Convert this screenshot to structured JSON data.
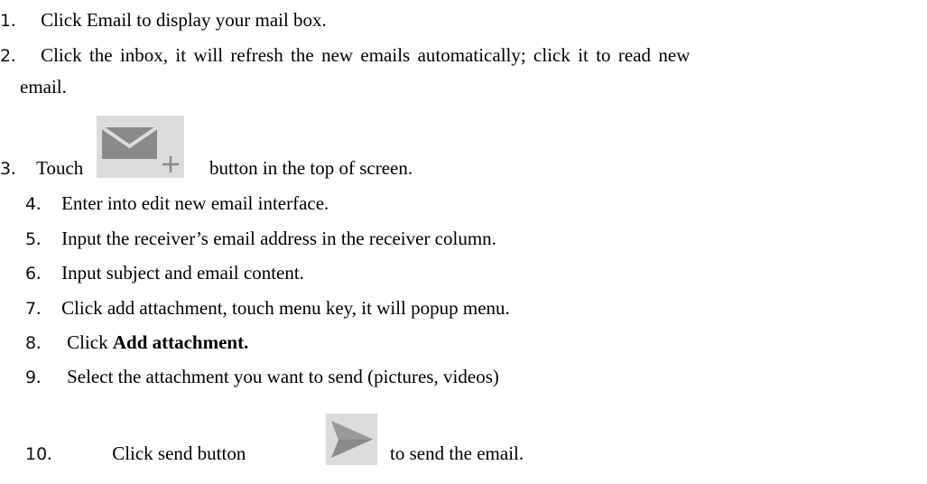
{
  "steps": [
    {
      "num": "1",
      "sep": ".",
      "text": "Click Email to display your mail box."
    },
    {
      "num": "2",
      "sep": ".",
      "text": "Click the inbox, it will refresh the new emails automatically; click it to read new",
      "text_cont": "email."
    },
    {
      "num": "3",
      "sep": ".",
      "text_before": "Touch",
      "text_after": "button in the top of screen.",
      "icon": "compose-email-icon"
    },
    {
      "num": "4",
      "sep": ".",
      "text": "Enter into edit new email interface."
    },
    {
      "num": "5",
      "sep": ".",
      "text": "Input the receiver’s email address in the receiver column."
    },
    {
      "num": "6",
      "sep": ".",
      "text": "Input subject and email content."
    },
    {
      "num": "7",
      "sep": ".",
      "text": "Click add attachment, touch menu key, it will popup menu."
    },
    {
      "num": "8",
      "sep": ".",
      "text_before": "Click ",
      "text_bold": "Add attachment."
    },
    {
      "num": "9",
      "sep": ".",
      "text": "Select the attachment you want to send (pictures, videos)"
    },
    {
      "num": "10",
      "sep": ".",
      "text_before": "Click send button",
      "text_after": "to send the email.",
      "icon": "send-icon"
    }
  ],
  "colors": {
    "icon_bg": "#dcdcdc",
    "icon_fg": "#8a8a8a"
  }
}
